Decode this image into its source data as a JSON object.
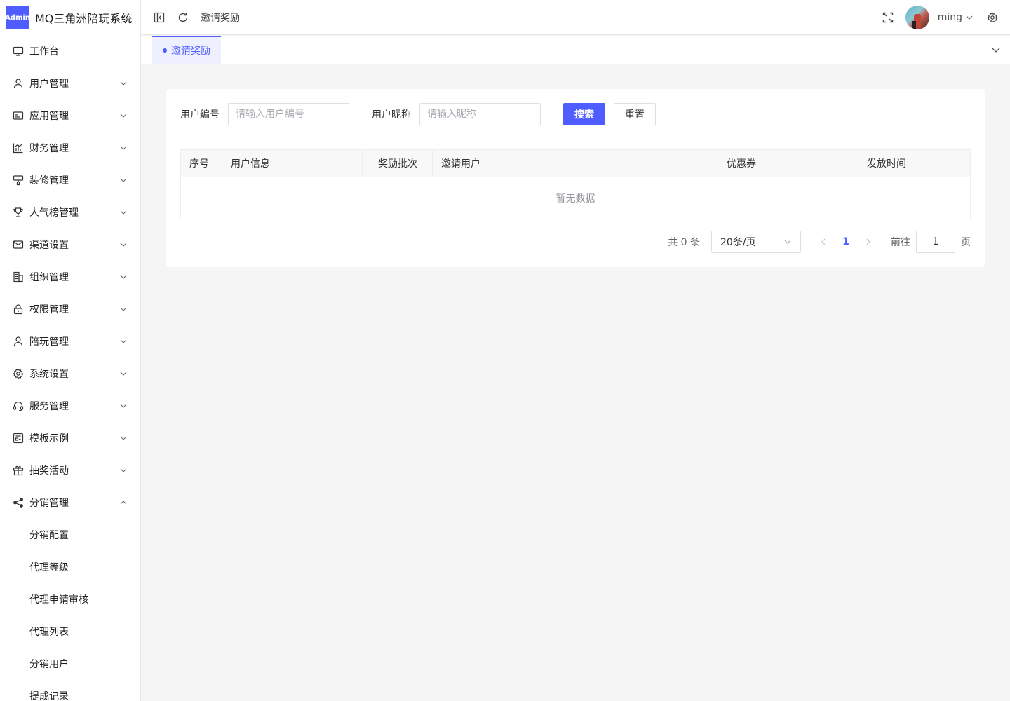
{
  "app": {
    "badge": "Admin",
    "title": "MQ三角洲陪玩系统"
  },
  "sidebar": {
    "items": [
      {
        "label": "工作台",
        "icon": "monitor-icon",
        "expandable": false
      },
      {
        "label": "用户管理",
        "icon": "user-icon",
        "expandable": true
      },
      {
        "label": "应用管理",
        "icon": "app-card-icon",
        "expandable": true
      },
      {
        "label": "财务管理",
        "icon": "chart-icon",
        "expandable": true
      },
      {
        "label": "装修管理",
        "icon": "paint-icon",
        "expandable": true
      },
      {
        "label": "人气榜管理",
        "icon": "trophy-icon",
        "expandable": true
      },
      {
        "label": "渠道设置",
        "icon": "mail-icon",
        "expandable": true
      },
      {
        "label": "组织管理",
        "icon": "building-icon",
        "expandable": true
      },
      {
        "label": "权限管理",
        "icon": "lock-icon",
        "expandable": true
      },
      {
        "label": "陪玩管理",
        "icon": "user-icon",
        "expandable": true
      },
      {
        "label": "系统设置",
        "icon": "gear-icon",
        "expandable": true
      },
      {
        "label": "服务管理",
        "icon": "headset-icon",
        "expandable": true
      },
      {
        "label": "模板示例",
        "icon": "template-icon",
        "expandable": true
      },
      {
        "label": "抽奖活动",
        "icon": "gift-icon",
        "expandable": true
      },
      {
        "label": "分销管理",
        "icon": "share-icon",
        "expandable": true,
        "expanded": true
      }
    ],
    "sub_items": [
      "分销配置",
      "代理等级",
      "代理申请审核",
      "代理列表",
      "分销用户",
      "提成记录"
    ]
  },
  "header": {
    "breadcrumb": "邀请奖励",
    "username": "ming"
  },
  "tabs": [
    {
      "label": "邀请奖励",
      "active": true
    }
  ],
  "search_form": {
    "user_id_label": "用户编号",
    "user_id_placeholder": "请输入用户编号",
    "nickname_label": "用户昵称",
    "nickname_placeholder": "请输入昵称",
    "search_button": "搜索",
    "reset_button": "重置"
  },
  "table": {
    "columns": [
      "序号",
      "用户信息",
      "奖励批次",
      "邀请用户",
      "优惠券",
      "发放时间"
    ],
    "empty_text": "暂无数据"
  },
  "pagination": {
    "total_text": "共 0 条",
    "page_size": "20条/页",
    "current_page": "1",
    "goto_label": "前往",
    "goto_value": "1",
    "page_suffix": "页"
  },
  "colors": {
    "accent": "#4f5dff"
  }
}
